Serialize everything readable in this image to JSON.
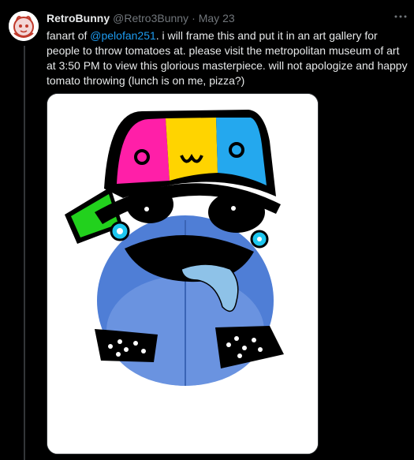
{
  "tweet": {
    "display_name": "RetroBunny",
    "handle": "@Retro3Bunny",
    "separator": "·",
    "date": "May 23",
    "text_before_mention": "fanart of ",
    "mention": "@pelofan251",
    "text_after_mention": ". i will frame this and put it in an art gallery for people to throw tomatoes at. please visit the metropolitan museum of art at 3:50 PM to view this glorious masterpiece. will not apologize and happy tomato throwing (lunch is on me, pizza?)",
    "more_icon": "more-horizontal-icon",
    "media_alt": "drawing of a blue plush creature with a pink, yellow and blue cap reading OωO"
  },
  "colors": {
    "background": "#000000",
    "text_primary": "#e7e9ea",
    "text_secondary": "#71767b",
    "link": "#1d9bf0"
  }
}
